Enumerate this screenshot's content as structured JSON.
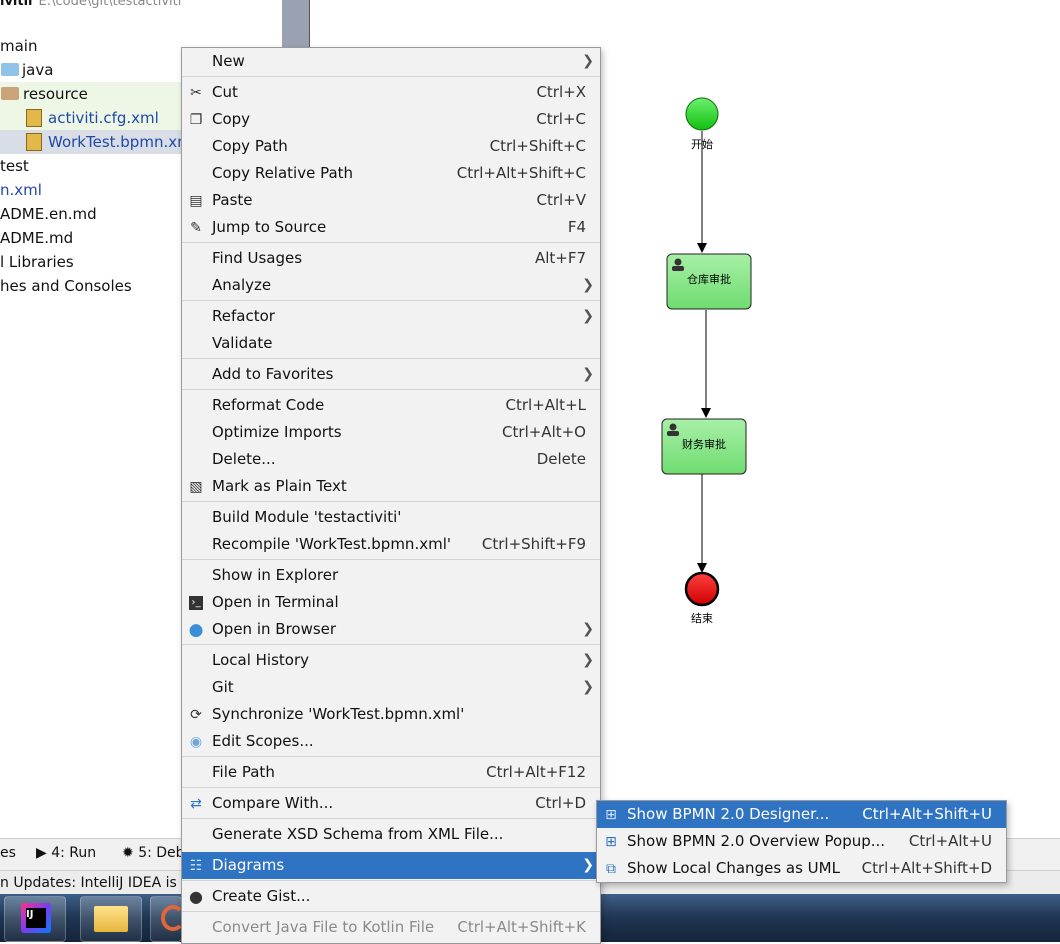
{
  "tree": {
    "title": "ivitii",
    "title_path": "E:\\code\\git\\testactiviti",
    "rows": [
      "main",
      "java",
      "resource",
      "activiti.cfg.xml",
      "WorkTest.bpmn.xml",
      "test",
      "n.xml",
      "ADME.en.md",
      "ADME.md",
      "l Libraries",
      "hes and Consoles"
    ]
  },
  "diagram": {
    "start_label": "开始",
    "task1_label": "仓库审批",
    "task2_label": "财务审批",
    "end_label": "结束"
  },
  "menu": {
    "new": "New",
    "cut": "Cut",
    "cut_sc": "Ctrl+X",
    "copy": "Copy",
    "copy_sc": "Ctrl+C",
    "copy_path": "Copy Path",
    "copy_path_sc": "Ctrl+Shift+C",
    "copy_rel": "Copy Relative Path",
    "copy_rel_sc": "Ctrl+Alt+Shift+C",
    "paste": "Paste",
    "paste_sc": "Ctrl+V",
    "jump": "Jump to Source",
    "jump_sc": "F4",
    "find_usages": "Find Usages",
    "find_usages_sc": "Alt+F7",
    "analyze": "Analyze",
    "refactor": "Refactor",
    "validate": "Validate",
    "favorites": "Add to Favorites",
    "reformat": "Reformat Code",
    "reformat_sc": "Ctrl+Alt+L",
    "optimize": "Optimize Imports",
    "optimize_sc": "Ctrl+Alt+O",
    "delete": "Delete...",
    "delete_sc": "Delete",
    "plain": "Mark as Plain Text",
    "build": "Build Module 'testactiviti'",
    "recompile": "Recompile 'WorkTest.bpmn.xml'",
    "recompile_sc": "Ctrl+Shift+F9",
    "explorer": "Show in Explorer",
    "terminal": "Open in Terminal",
    "browser": "Open in Browser",
    "history": "Local History",
    "git": "Git",
    "sync": "Synchronize 'WorkTest.bpmn.xml'",
    "scopes": "Edit Scopes...",
    "file_path": "File Path",
    "file_path_sc": "Ctrl+Alt+F12",
    "compare": "Compare With...",
    "compare_sc": "Ctrl+D",
    "xsd": "Generate XSD Schema from XML File...",
    "diagrams": "Diagrams",
    "gist": "Create Gist...",
    "kotlin": "Convert Java File to Kotlin File",
    "kotlin_sc": "Ctrl+Alt+Shift+K"
  },
  "submenu": {
    "designer": "Show BPMN 2.0 Designer...",
    "designer_sc": "Ctrl+Alt+Shift+U",
    "overview": "Show BPMN 2.0 Overview Popup...",
    "overview_sc": "Ctrl+Alt+U",
    "changes": "Show Local Changes as UML",
    "changes_sc": "Ctrl+Alt+Shift+D"
  },
  "toolwindows": {
    "left_stub": "es",
    "run": "4: Run",
    "debug": "5: Deb"
  },
  "status": {
    "text": "n Updates: IntelliJ IDEA is"
  },
  "colors": {
    "accent": "#2f73c3",
    "start": "#22dd22",
    "task": "#88e888",
    "end": "#ee1111"
  }
}
